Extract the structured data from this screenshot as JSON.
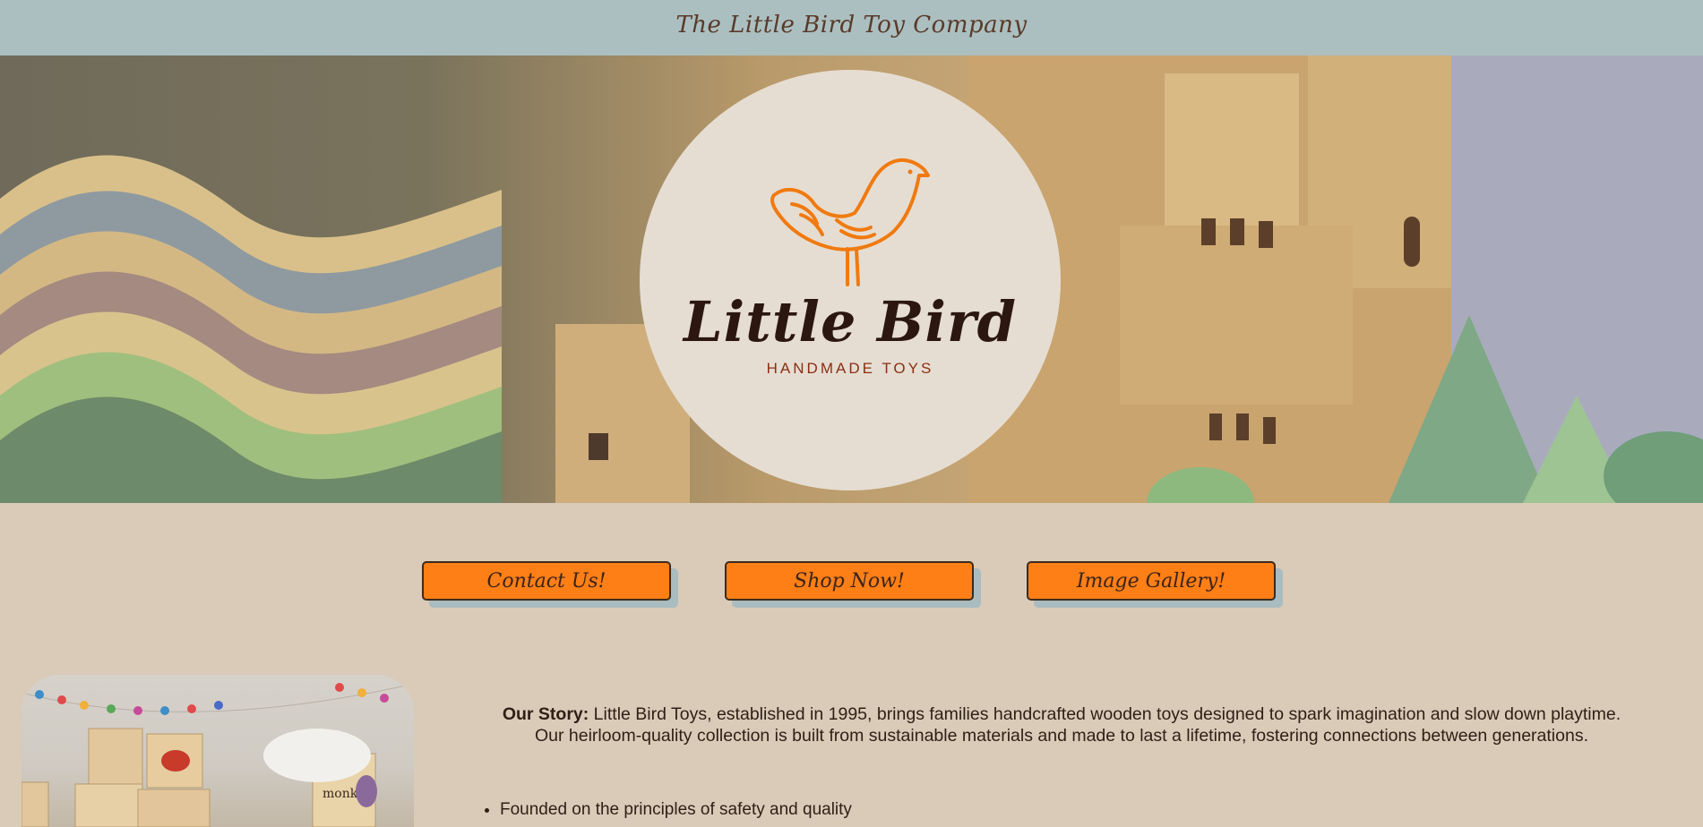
{
  "header": {
    "site_title": "The Little Bird Toy Company"
  },
  "logo": {
    "name": "Little Bird",
    "tagline": "HANDMADE TOYS",
    "accent": "#ff7f17"
  },
  "nav_buttons": [
    {
      "label": "Contact Us!"
    },
    {
      "label": "Shop Now!"
    },
    {
      "label": "Image Gallery!"
    }
  ],
  "story": {
    "heading": "Our Story:",
    "text": " Little Bird Toys, established in 1995, brings families handcrafted wooden toys designed to spark imagination and slow down playtime. Our heirloom-quality collection is built from sustainable materials and made to last a lifetime, fostering connections between generations."
  },
  "highlights": [
    "Founded on the principles of safety and quality"
  ],
  "photo": {
    "block_word": "monkey"
  },
  "colors": {
    "topbar": "#abbfc0",
    "page_bg": "#d9cbb8",
    "button": "#ff7f17",
    "button_shadow": "#a9bcc0"
  }
}
